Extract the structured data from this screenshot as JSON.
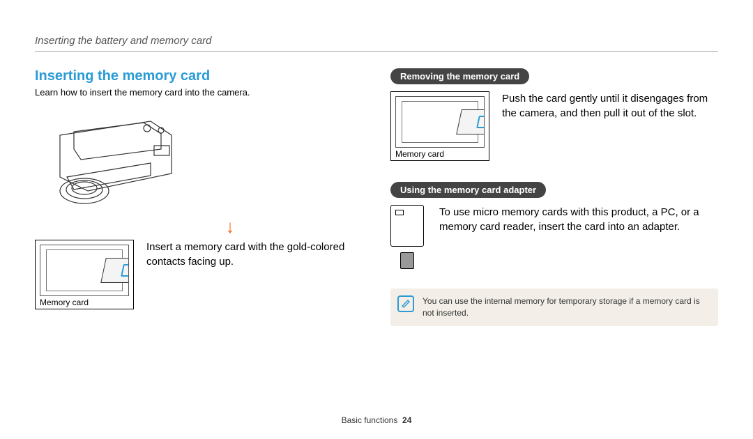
{
  "header": {
    "breadcrumb": "Inserting the battery and memory card"
  },
  "left": {
    "title": "Inserting the memory card",
    "desc": "Learn how to insert the memory card into the camera.",
    "slot_caption": "Memory card",
    "instruction": "Insert a memory card with the gold-colored contacts facing up."
  },
  "right": {
    "removing": {
      "pill": "Removing the memory card",
      "slot_caption": "Memory card",
      "text": "Push the card gently until it disengages from the camera, and then pull it out of the slot."
    },
    "adapter": {
      "pill": "Using the memory card adapter",
      "text": "To use micro memory cards with this product, a PC, or a memory card reader, insert the card into an adapter."
    },
    "note": "You can use the internal memory for temporary storage if a memory card is not inserted."
  },
  "footer": {
    "section": "Basic functions",
    "page": "24"
  }
}
